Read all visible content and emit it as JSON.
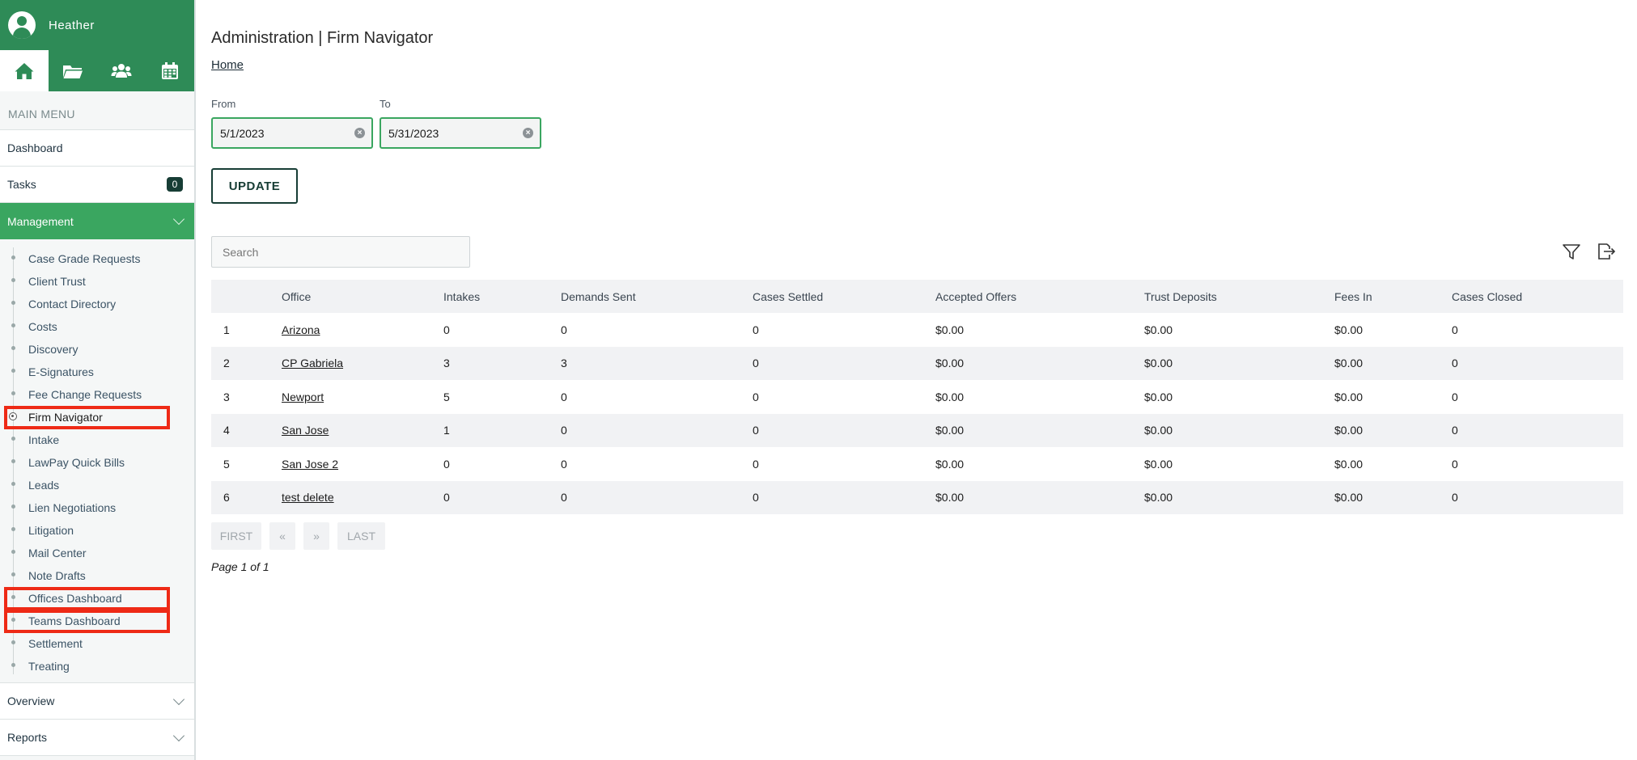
{
  "user": {
    "name": "Heather"
  },
  "nav_icons": [
    "home-icon",
    "folder-icon",
    "users-icon",
    "calendar-icon"
  ],
  "sidebar": {
    "heading": "MAIN MENU",
    "dashboard": "Dashboard",
    "tasks": {
      "label": "Tasks",
      "count": "0"
    },
    "management": "Management",
    "submenu": [
      "Case Grade Requests",
      "Client Trust",
      "Contact Directory",
      "Costs",
      "Discovery",
      "E-Signatures",
      "Fee Change Requests",
      "Firm Navigator",
      "Intake",
      "LawPay Quick Bills",
      "Leads",
      "Lien Negotiations",
      "Litigation",
      "Mail Center",
      "Note Drafts",
      "Offices Dashboard",
      "Teams Dashboard",
      "Settlement",
      "Treating"
    ],
    "current": "Firm Navigator",
    "overview": "Overview",
    "reports": "Reports"
  },
  "header": {
    "title": "Administration | Firm Navigator",
    "breadcrumb": "Home"
  },
  "filters": {
    "from_label": "From",
    "from_value": "5/1/2023",
    "to_label": "To",
    "to_value": "5/31/2023",
    "update_label": "UPDATE"
  },
  "search": {
    "placeholder": "Search"
  },
  "table": {
    "columns": [
      "",
      "Office",
      "Intakes",
      "Demands Sent",
      "Cases Settled",
      "Accepted Offers",
      "Trust Deposits",
      "Fees In",
      "Cases Closed"
    ],
    "rows": [
      [
        "1",
        "Arizona",
        "0",
        "0",
        "0",
        "$0.00",
        "$0.00",
        "$0.00",
        "0"
      ],
      [
        "2",
        "CP Gabriela",
        "3",
        "3",
        "0",
        "$0.00",
        "$0.00",
        "$0.00",
        "0"
      ],
      [
        "3",
        "Newport",
        "5",
        "0",
        "0",
        "$0.00",
        "$0.00",
        "$0.00",
        "0"
      ],
      [
        "4",
        "San Jose",
        "1",
        "0",
        "0",
        "$0.00",
        "$0.00",
        "$0.00",
        "0"
      ],
      [
        "5",
        "San Jose 2",
        "0",
        "0",
        "0",
        "$0.00",
        "$0.00",
        "$0.00",
        "0"
      ],
      [
        "6",
        "test delete",
        "0",
        "0",
        "0",
        "$0.00",
        "$0.00",
        "$0.00",
        "0"
      ]
    ]
  },
  "pagination": {
    "first": "FIRST",
    "prev": "«",
    "next": "»",
    "last": "LAST",
    "info": "Page 1 of 1"
  },
  "colors": {
    "brand_green": "#2e8b57",
    "active_green": "#3aa660",
    "highlight_red": "#ee2a16",
    "dark_teal": "#173d35"
  }
}
